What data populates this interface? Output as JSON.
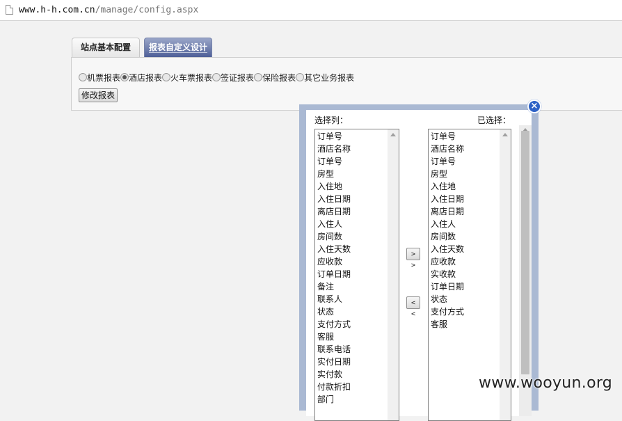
{
  "browser": {
    "url_host": "www.h-h.com.cn",
    "url_path": "/manage/config.aspx"
  },
  "tabs": [
    {
      "label": "站点基本配置",
      "active": false
    },
    {
      "label": "报表自定义设计",
      "active": true
    }
  ],
  "report_types": [
    {
      "label": "机票报表",
      "checked": false
    },
    {
      "label": "酒店报表",
      "checked": true
    },
    {
      "label": "火车票报表",
      "checked": false
    },
    {
      "label": "签证报表",
      "checked": false
    },
    {
      "label": "保险报表",
      "checked": false
    },
    {
      "label": "其它业务报表",
      "checked": false
    }
  ],
  "modify_button": "修改报表",
  "dialog": {
    "available_label": "选择列：",
    "selected_label": "已选择：",
    "add_button": "> >",
    "remove_button": "< <",
    "close_icon": "×",
    "available_columns": [
      "订单号",
      "酒店名称",
      "订单号",
      "房型",
      "入住地",
      "入住日期",
      "离店日期",
      "入住人",
      "房间数",
      "入住天数",
      "应收款",
      "订单日期",
      "备注",
      "联系人",
      "状态",
      "支付方式",
      "客服",
      "联系电话",
      "实付日期",
      "实付款",
      "付款折扣",
      "部门"
    ],
    "selected_columns": [
      "订单号",
      "酒店名称",
      "订单号",
      "房型",
      "入住地",
      "入住日期",
      "离店日期",
      "入住人",
      "房间数",
      "入住天数",
      "应收款",
      "实收款",
      "订单日期",
      "状态",
      "支付方式",
      "客服"
    ]
  },
  "watermark": "www.wooyun.org"
}
